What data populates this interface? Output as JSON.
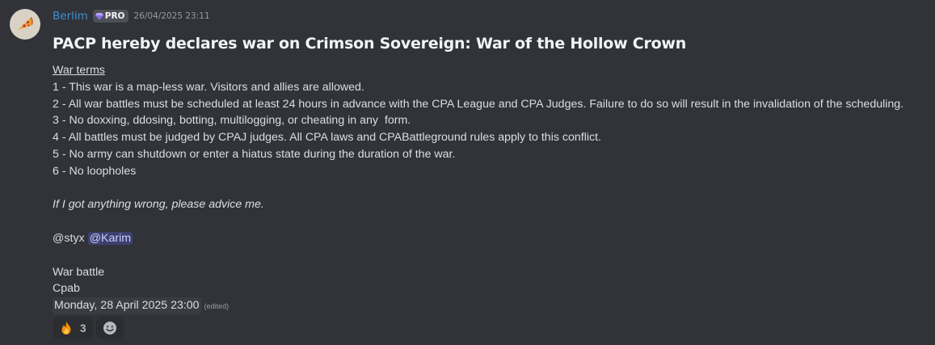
{
  "message": {
    "author": "Berlim",
    "badge": "PRO",
    "timestamp": "26/04/2025 23:11",
    "avatar_icon": "pizza-icon",
    "title": "PACP hereby declares war on Crimson Sovereign: War of the Hollow Crown",
    "terms_heading": "War terms",
    "terms": [
      "1 - This war is a map-less war. Visitors and allies are allowed.",
      "2 - All war battles must be scheduled at least 24 hours in advance with the CPA League and CPA Judges. Failure to do so will result in the invalidation of the scheduling.",
      "3 - No doxxing, ddosing, botting, multilogging, or cheating in any  form.",
      "4 - All battles must be judged by CPAJ judges. All CPA laws and CPABattleground rules apply to this conflict.",
      "5 - No army can shutdown or enter a hiatus state during the duration of the war.",
      "6 - No loopholes"
    ],
    "note": "If I got anything wrong, please advice me.",
    "mention_plain": "@styx",
    "mention_highlight": "@Karim",
    "battle_label": "War battle",
    "battle_army": "Cpab",
    "battle_date": "Monday, 28 April 2025 23:00",
    "edited_label": "(edited)"
  },
  "reactions": [
    {
      "icon": "fire-icon",
      "count": "3"
    }
  ],
  "add_reaction_icon": "smile-icon",
  "colors": {
    "background": "#313338",
    "username": "#3f8fd0",
    "mention_bg": "rgba(88,101,242,0.3)",
    "mention_text": "#c9cdfb"
  }
}
